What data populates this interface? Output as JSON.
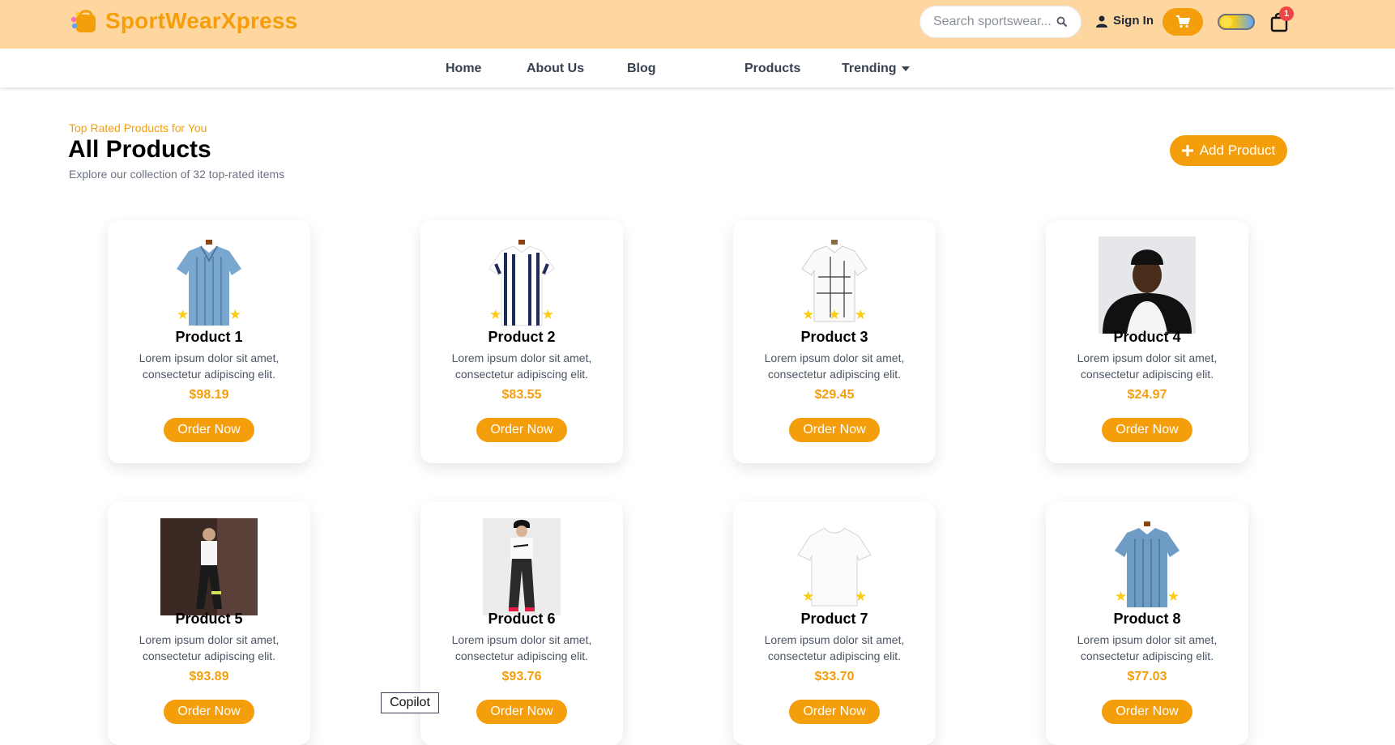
{
  "brand": {
    "name": "SportWearXpress",
    "accent": "#f59e0b",
    "topbar_bg": "#fed7a0"
  },
  "header": {
    "search_placeholder": "Search sportswear...",
    "signin_label": "Sign In",
    "cart_icon": "cart-icon",
    "bag_count": "1"
  },
  "nav": {
    "items": [
      {
        "label": "Home"
      },
      {
        "label": "About Us"
      },
      {
        "label": "Blog"
      },
      {
        "label": "Products"
      },
      {
        "label": "Trending"
      }
    ]
  },
  "main": {
    "eyebrow": "Top Rated Products for You",
    "title": "All Products",
    "subtitle": "Explore our collection of 32 top-rated items",
    "add_label": "Add Product"
  },
  "products": [
    {
      "name": "Product 1",
      "desc": "Lorem ipsum dolor sit amet, consectetur adipiscing elit.",
      "price": "$98.19",
      "button": "Order Now",
      "image": "blue-striped-shirt"
    },
    {
      "name": "Product 2",
      "desc": "Lorem ipsum dolor sit amet, consectetur adipiscing elit.",
      "price": "$83.55",
      "button": "Order Now",
      "image": "navy-striped-shirt"
    },
    {
      "name": "Product 3",
      "desc": "Lorem ipsum dolor sit amet, consectetur adipiscing elit.",
      "price": "$29.45",
      "button": "Order Now",
      "image": "white-check-shirt"
    },
    {
      "name": "Product 4",
      "desc": "Lorem ipsum dolor sit amet, consectetur adipiscing elit.",
      "price": "$24.97",
      "button": "Order Now",
      "image": "model-hoodie"
    },
    {
      "name": "Product 5",
      "desc": "Lorem ipsum dolor sit amet, consectetur adipiscing elit.",
      "price": "$93.89",
      "button": "Order Now",
      "image": "model-joggers"
    },
    {
      "name": "Product 6",
      "desc": "Lorem ipsum dolor sit amet, consectetur adipiscing elit.",
      "price": "$93.76",
      "button": "Order Now",
      "image": "model-cap-outfit"
    },
    {
      "name": "Product 7",
      "desc": "Lorem ipsum dolor sit amet, consectetur adipiscing elit.",
      "price": "$33.70",
      "button": "Order Now",
      "image": "white-tshirt"
    },
    {
      "name": "Product 8",
      "desc": "Lorem ipsum dolor sit amet, consectetur adipiscing elit.",
      "price": "$77.03",
      "button": "Order Now",
      "image": "blue-shirt"
    }
  ],
  "overlay": {
    "copilot_label": "Copilot"
  }
}
